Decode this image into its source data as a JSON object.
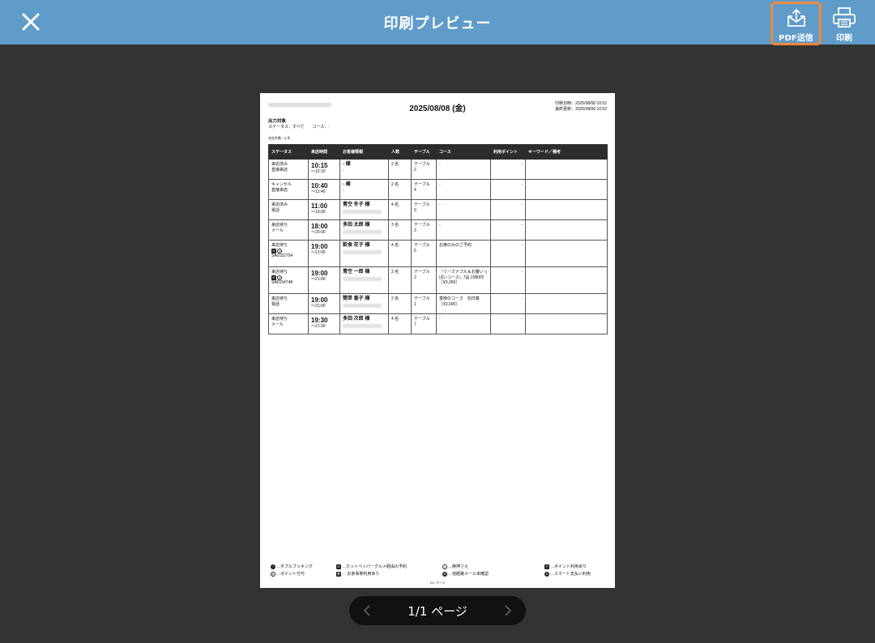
{
  "header": {
    "title": "印刷プレビュー",
    "pdf_label": "PDF送信",
    "print_label": "印刷"
  },
  "colors": {
    "header_bg": "#5f9cc9",
    "highlight": "#f0883b",
    "viewer_bg": "#333333"
  },
  "document": {
    "date": "2025/08/08 (金)",
    "printed": "印刷日時：2025/08/08 10:52",
    "updated": "最終更新：2025/08/08 10:52",
    "target_label": "出力対象",
    "condition": "ステータス：すべて　　コース：-",
    "count": "合計件数：8 件",
    "columns": [
      "ステータス",
      "来店時間",
      "お客様情報",
      "人数",
      "テーブル",
      "コース",
      "利用ポイント",
      "キーワード／備考"
    ],
    "rows": [
      {
        "status1": "来店済み",
        "status2": "直接来店",
        "time": "10:15",
        "end": "～12:15",
        "name": "- 様",
        "sub": "-",
        "people": "2 名",
        "table1": "テーブル",
        "table2": "2",
        "course": "-",
        "points": "-"
      },
      {
        "status1": "キャンセル",
        "status2": "直接来店",
        "time": "10:40",
        "end": "～12:40",
        "name": "- 様",
        "sub": "-",
        "people": "2 名",
        "table1": "テーブル",
        "table2": "4",
        "course": "-",
        "points": "-"
      },
      {
        "status1": "来店済み",
        "status2": "電話",
        "time": "11:00",
        "end": "～13:00",
        "name": "青空 冬子 様",
        "sub": "",
        "people": "4 名",
        "table1": "テーブル",
        "table2": "9",
        "course": "-",
        "points": "-"
      },
      {
        "status1": "来店待ち",
        "status2": "メール",
        "time": "18:00",
        "end": "～20:00",
        "name": "多田 太郎 様",
        "sub": "",
        "people": "3 名",
        "table1": "テーブル",
        "table2": "3",
        "course": "-",
        "points": "-"
      },
      {
        "status1": "来店待ち",
        "status2": "",
        "id": "SA0152754",
        "time": "19:00",
        "end": "～21:00",
        "name": "飲食 花子 様",
        "sub": "",
        "people": "4 名",
        "table1": "テーブル",
        "table2": "5",
        "course": "お席のみのご予約",
        "points": "-"
      },
      {
        "status1": "来店待ち",
        "status2": "",
        "id": "SA0154748",
        "time": "19:00",
        "end": "～21:00",
        "name": "青空 一郎 様",
        "sub": "",
        "people": "2 名",
        "table1": "テーブル",
        "table2": "2",
        "course": "『リーズナブル＆お腹いっぱいコース』7品 2980円［¥3,356］",
        "points": "-"
      },
      {
        "status1": "来店待ち",
        "status2": "電話",
        "time": "19:00",
        "end": "～21:00",
        "name": "簡単 番子 様",
        "sub": "",
        "people": "2 名",
        "table1": "テーブル",
        "table2": "1",
        "course": "季節のコース　向日葵［¥3,000］",
        "points": "-"
      },
      {
        "status1": "来店待ち",
        "status2": "メール",
        "time": "19:30",
        "end": "～21:30",
        "name": "多田 次郎 様",
        "sub": "",
        "people": "4 名",
        "table1": "テーブル",
        "table2": "7",
        "course": "-",
        "points": "-"
      }
    ],
    "legend": {
      "double": "…ダブルブッキング",
      "point_grant": "…ポイント付与",
      "hotpepper": "…ホットペッパーグルメ経由の予約",
      "meal_ticket": "… お食事券利用あり",
      "seat_hold": "…席押さえ",
      "mail_unconfirmed": "…他経路メール未確認",
      "point_use": "…ポイント利用あり",
      "smart_pay": "…スマート支払い利用"
    },
    "page_number": "1/1 ページ"
  },
  "pager": {
    "label": "1/1 ページ"
  }
}
